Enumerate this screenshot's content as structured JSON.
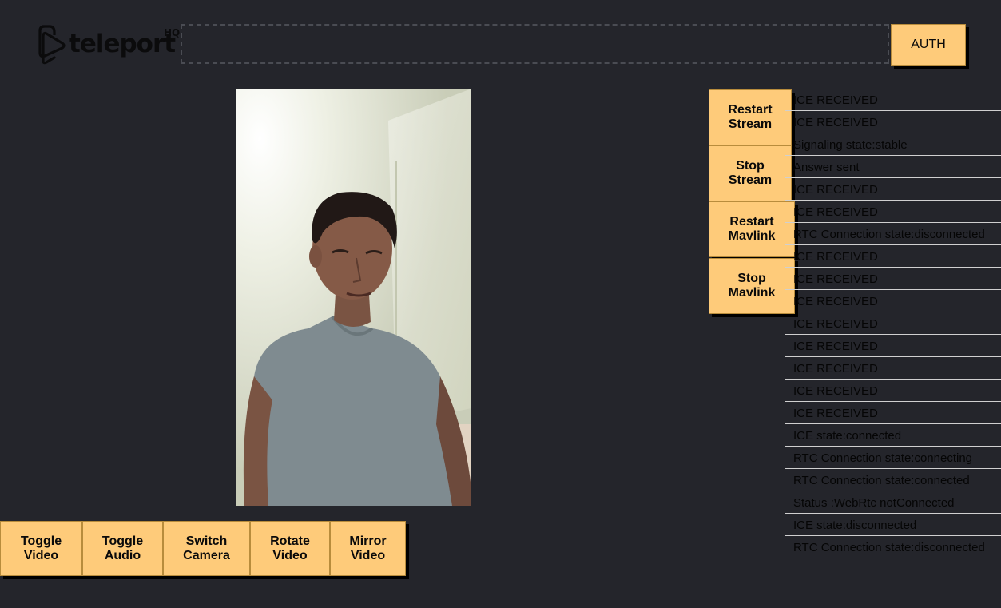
{
  "header": {
    "logo_text": "teleport",
    "logo_suffix": "HQ",
    "token_value": "",
    "auth_label": "AUTH"
  },
  "stream_controls": {
    "restart_stream": "Restart\nStream",
    "stop_stream": "Stop\nStream",
    "restart_mavlink": "Restart\nMavlink",
    "stop_mavlink": "Stop\nMavlink"
  },
  "video_controls": {
    "toggle_video": "Toggle\nVideo",
    "toggle_audio": "Toggle\nAudio",
    "switch_camera": "Switch\nCamera",
    "rotate_video": "Rotate\nVideo",
    "mirror_video": "Mirror\nVideo"
  },
  "log": [
    "ICE RECEIVED",
    "ICE RECEIVED",
    "Signaling state:stable",
    "Answer sent",
    "ICE RECEIVED",
    "ICE RECEIVED",
    "RTC Connection state:disconnected",
    "ICE RECEIVED",
    "ICE RECEIVED",
    "ICE RECEIVED",
    "ICE RECEIVED",
    "ICE RECEIVED",
    "ICE RECEIVED",
    "ICE RECEIVED",
    "ICE RECEIVED",
    "ICE state:connected",
    "RTC Connection state:connecting",
    "RTC Connection state:connected",
    "Status :WebRtc notConnected",
    "ICE state:disconnected",
    "RTC Connection state:disconnected"
  ],
  "colors": {
    "background": "#24252b",
    "button": "#fecb7a",
    "text": "#050505"
  }
}
